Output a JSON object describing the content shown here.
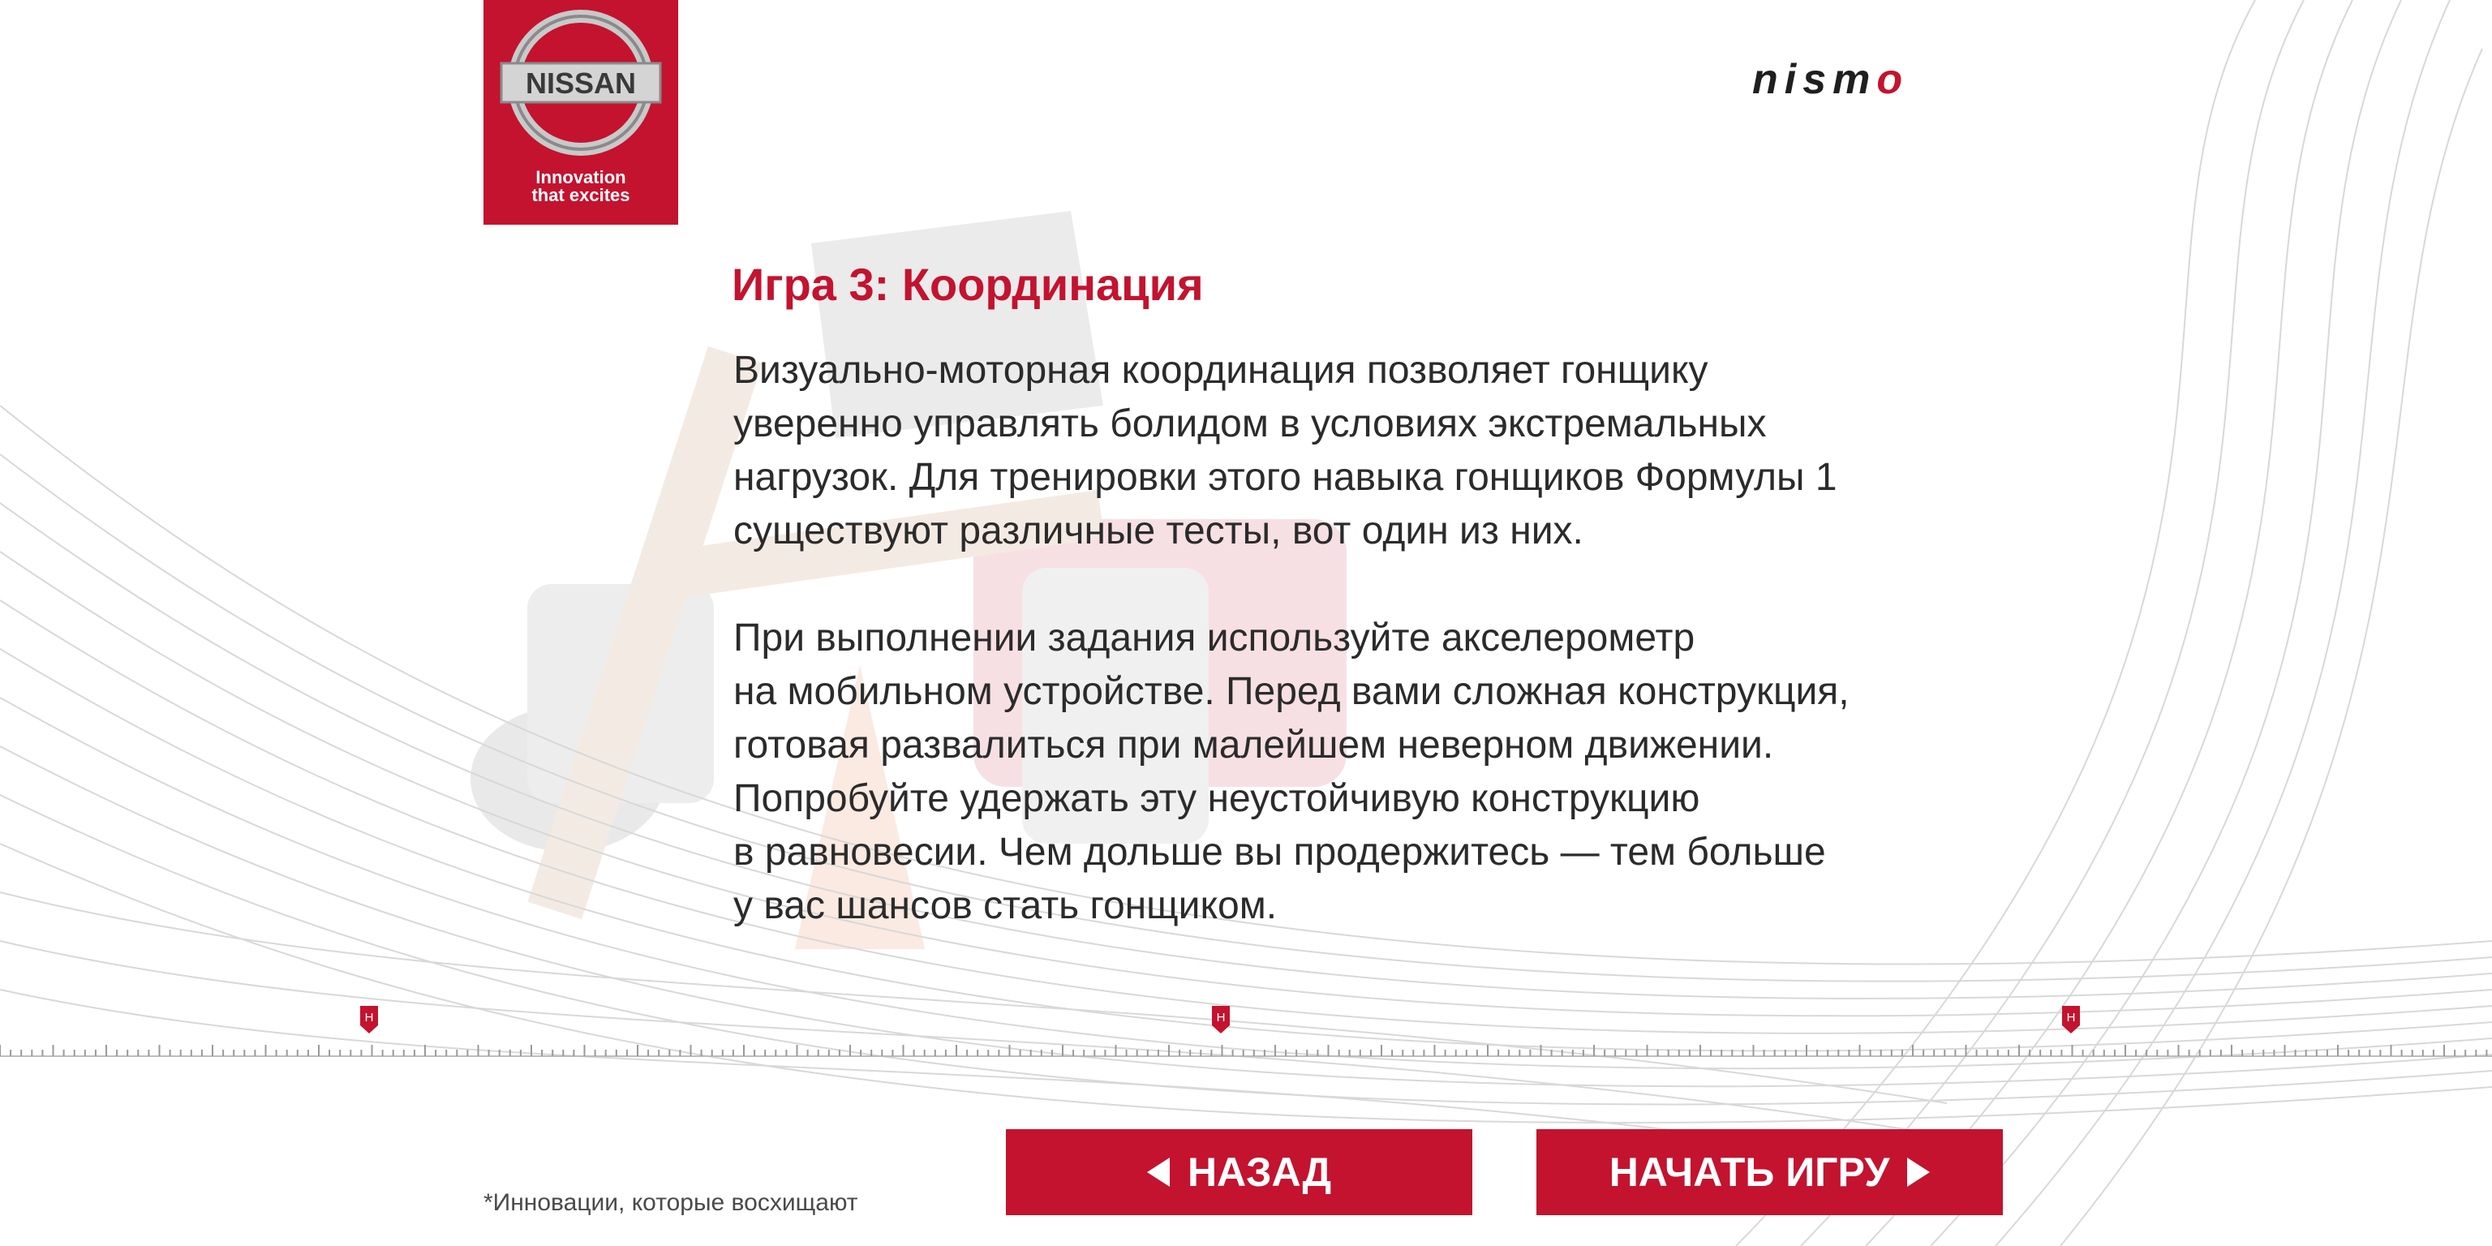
{
  "brand": {
    "logo_text": "NISSAN",
    "tagline_line1": "Innovation",
    "tagline_line2": "that excites",
    "nismo_prefix": "nism",
    "nismo_suffix": "o",
    "red": "#c3132f"
  },
  "content": {
    "title": "Игра 3: Координация",
    "paragraph1": [
      "Визуально-моторная координация позволяет гонщику",
      "уверенно управлять болидом в условиях экстремальных",
      "нагрузок. Для тренировки этого навыка гонщиков Формулы 1",
      "существуют различные тесты, вот один из них."
    ],
    "paragraph2": [
      "При выполнении задания используйте акселерометр",
      "на мобильном устройстве. Перед вами сложная конструкция,",
      "готовая развалиться при малейшем неверном движении.",
      "Попробуйте удержать эту неустойчивую конструкцию",
      "в равновесии. Чем дольше вы продержитесь — тем больше",
      "у вас шансов стать гонщиком."
    ]
  },
  "timeline": {
    "marker_label": "Н",
    "marker_icon": "map-pin-icon"
  },
  "buttons": {
    "back_label": "НАЗАД",
    "start_label": "НАЧАТЬ ИГРУ"
  },
  "footnote": "*Инновации, которые восхищают"
}
